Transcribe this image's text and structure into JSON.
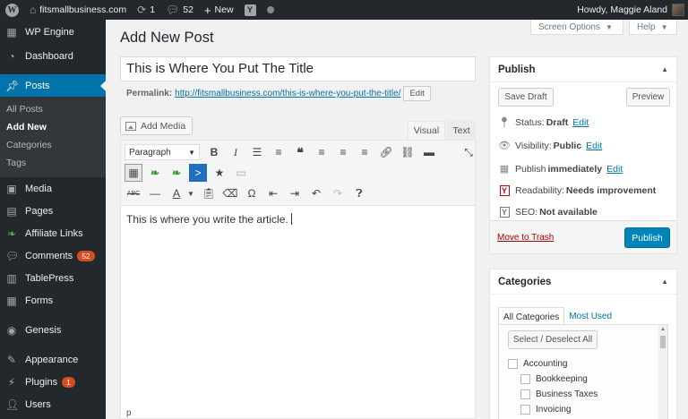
{
  "admin_bar": {
    "site_name": "fitsmallbusiness.com",
    "updates_count": "1",
    "comments_count": "52",
    "new_label": "New",
    "yoast_glyph": "Y",
    "howdy": "Howdy, Maggie Aland"
  },
  "sidebar": {
    "items": [
      {
        "label": "WP Engine",
        "icon": "wp-engine-icon"
      },
      {
        "label": "Dashboard",
        "icon": "dashboard-icon"
      },
      {
        "label": "Posts",
        "icon": "pin-icon"
      },
      {
        "label": "Media",
        "icon": "media-icon"
      },
      {
        "label": "Pages",
        "icon": "pages-icon"
      },
      {
        "label": "Affiliate Links",
        "icon": "affiliate-icon"
      },
      {
        "label": "Comments",
        "icon": "comment-icon",
        "badge": "52"
      },
      {
        "label": "TablePress",
        "icon": "table-icon"
      },
      {
        "label": "Forms",
        "icon": "forms-icon"
      },
      {
        "label": "Genesis",
        "icon": "genesis-icon"
      },
      {
        "label": "Appearance",
        "icon": "brush-icon"
      },
      {
        "label": "Plugins",
        "icon": "plugin-icon",
        "badge": "1"
      },
      {
        "label": "Users",
        "icon": "users-icon"
      }
    ],
    "posts_submenu": [
      "All Posts",
      "Add New",
      "Categories",
      "Tags"
    ]
  },
  "screen_options": "Screen Options",
  "help": "Help",
  "page_title": "Add New Post",
  "post": {
    "title": "This is Where You Put The Title",
    "permalink_label": "Permalink:",
    "permalink_url": "http://fitsmallbusiness.com/this-is-where-you-put-the-title/",
    "edit_label": "Edit",
    "content": "This is where you write the article.",
    "path": "p"
  },
  "editor": {
    "add_media": "Add Media",
    "tab_visual": "Visual",
    "tab_text": "Text",
    "format_select": "Paragraph"
  },
  "publish_box": {
    "title": "Publish",
    "save_draft": "Save Draft",
    "preview": "Preview",
    "status_label": "Status:",
    "status_value": "Draft",
    "visibility_label": "Visibility:",
    "visibility_value": "Public",
    "publish_label": "Publish",
    "publish_value": "immediately",
    "readability_label": "Readability:",
    "readability_value": "Needs improvement",
    "seo_label": "SEO:",
    "seo_value": "Not available",
    "edit": "Edit",
    "move_to_trash": "Move to Trash",
    "publish_button": "Publish"
  },
  "categories_box": {
    "title": "Categories",
    "tab_all": "All Categories",
    "tab_most_used": "Most Used",
    "select_all": "Select / Deselect All",
    "items": [
      "Accounting",
      "Bookkeeping",
      "Business Taxes",
      "Invoicing"
    ]
  },
  "colors": {
    "accent": "#0073aa",
    "admin_bar": "#23282d",
    "primary_button": "#0085ba",
    "badge": "#d54e21"
  }
}
